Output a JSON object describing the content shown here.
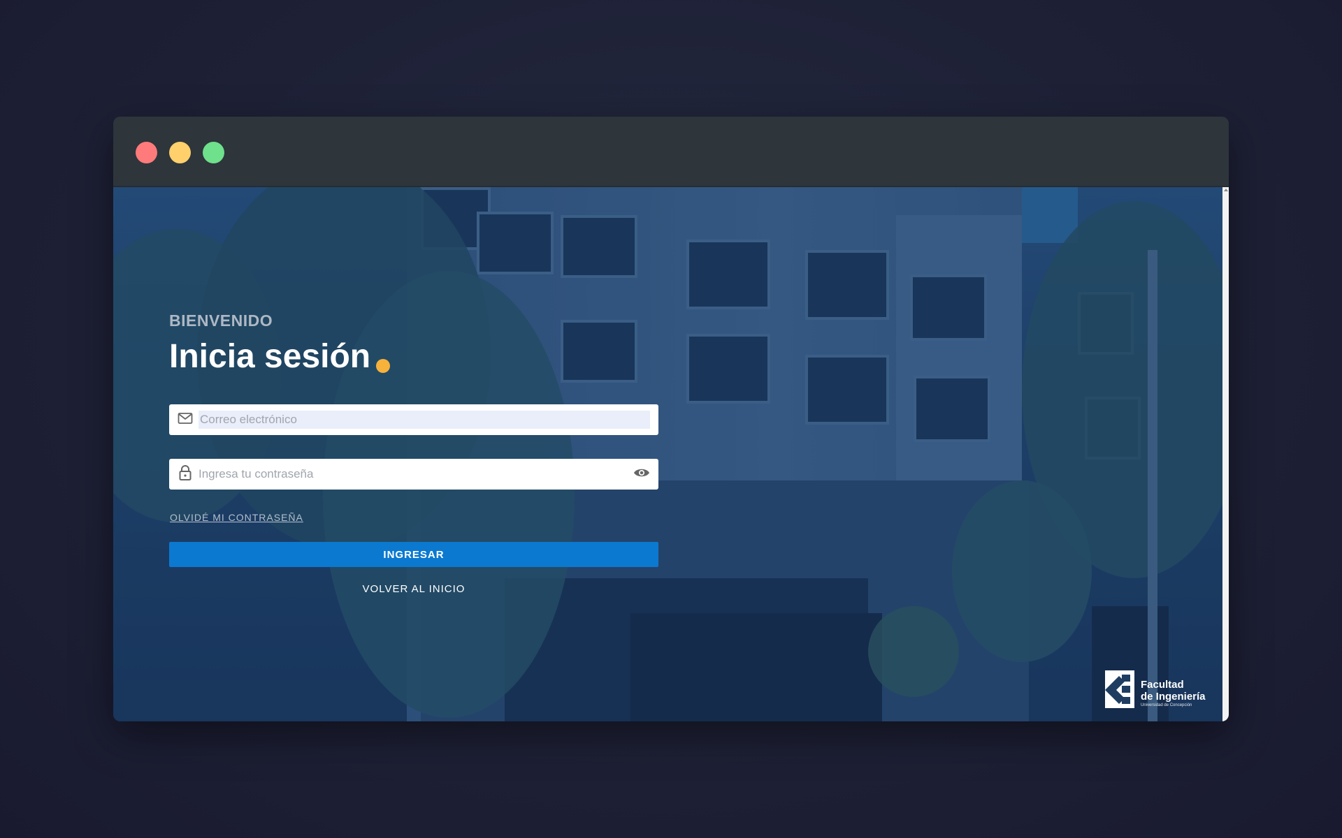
{
  "window": {
    "controls": {
      "close_color": "#ff7b7b",
      "minimize_color": "#ffd06b",
      "maximize_color": "#6fe08c"
    }
  },
  "login": {
    "welcome": "BIENVENIDO",
    "title": "Inicia sesión",
    "accent_color": "#f7b23b",
    "email": {
      "placeholder": "Correo electrónico",
      "icon": "mail-icon"
    },
    "password": {
      "placeholder": "Ingresa tu contraseña",
      "icon": "lock-icon",
      "toggle_icon": "eye-icon"
    },
    "forgot_link": "OLVIDÉ MI CONTRASEÑA",
    "submit_label": "INGRESAR",
    "back_label": "VOLVER AL INICIO",
    "button_color": "#0b79d0"
  },
  "logo": {
    "line1": "Facultad",
    "line2": "de Ingeniería",
    "subtitle": "Universidad de Concepción"
  }
}
